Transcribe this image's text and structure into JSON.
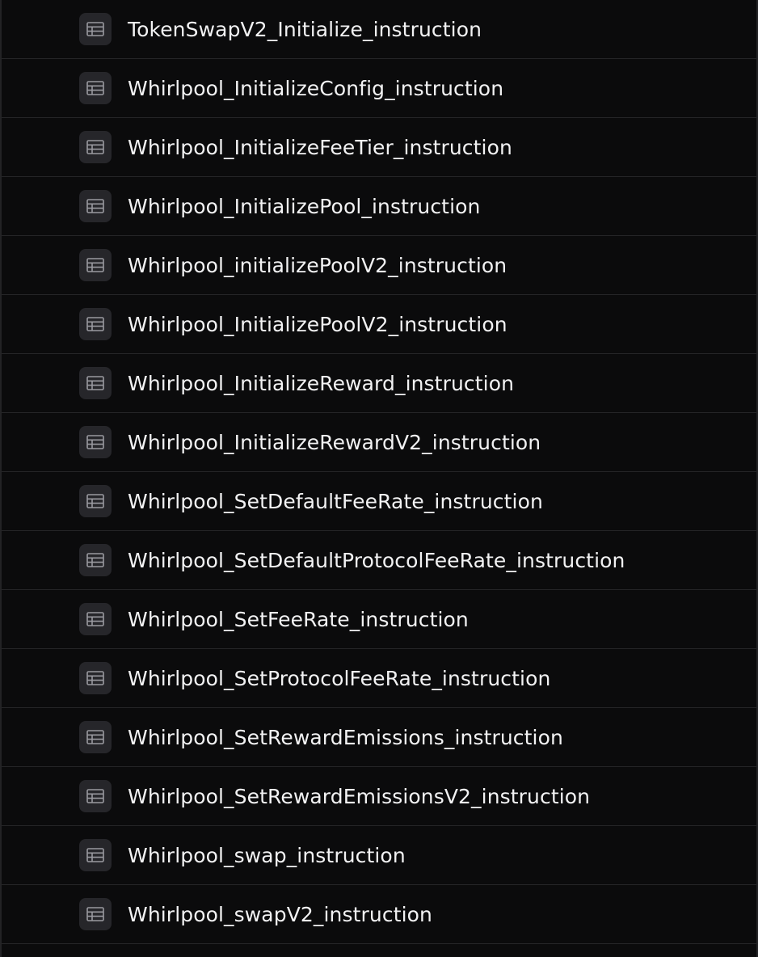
{
  "table_list": {
    "icon": "table-icon",
    "items": [
      {
        "label": "TokenSwapV2_Initialize_instruction"
      },
      {
        "label": "Whirlpool_InitializeConfig_instruction"
      },
      {
        "label": "Whirlpool_InitializeFeeTier_instruction"
      },
      {
        "label": "Whirlpool_InitializePool_instruction"
      },
      {
        "label": "Whirlpool_initializePoolV2_instruction"
      },
      {
        "label": "Whirlpool_InitializePoolV2_instruction"
      },
      {
        "label": "Whirlpool_InitializeReward_instruction"
      },
      {
        "label": "Whirlpool_InitializeRewardV2_instruction"
      },
      {
        "label": "Whirlpool_SetDefaultFeeRate_instruction"
      },
      {
        "label": "Whirlpool_SetDefaultProtocolFeeRate_instruction"
      },
      {
        "label": "Whirlpool_SetFeeRate_instruction"
      },
      {
        "label": "Whirlpool_SetProtocolFeeRate_instruction"
      },
      {
        "label": "Whirlpool_SetRewardEmissions_instruction"
      },
      {
        "label": "Whirlpool_SetRewardEmissionsV2_instruction"
      },
      {
        "label": "Whirlpool_swap_instruction"
      },
      {
        "label": "Whirlpool_swapV2_instruction"
      }
    ]
  }
}
